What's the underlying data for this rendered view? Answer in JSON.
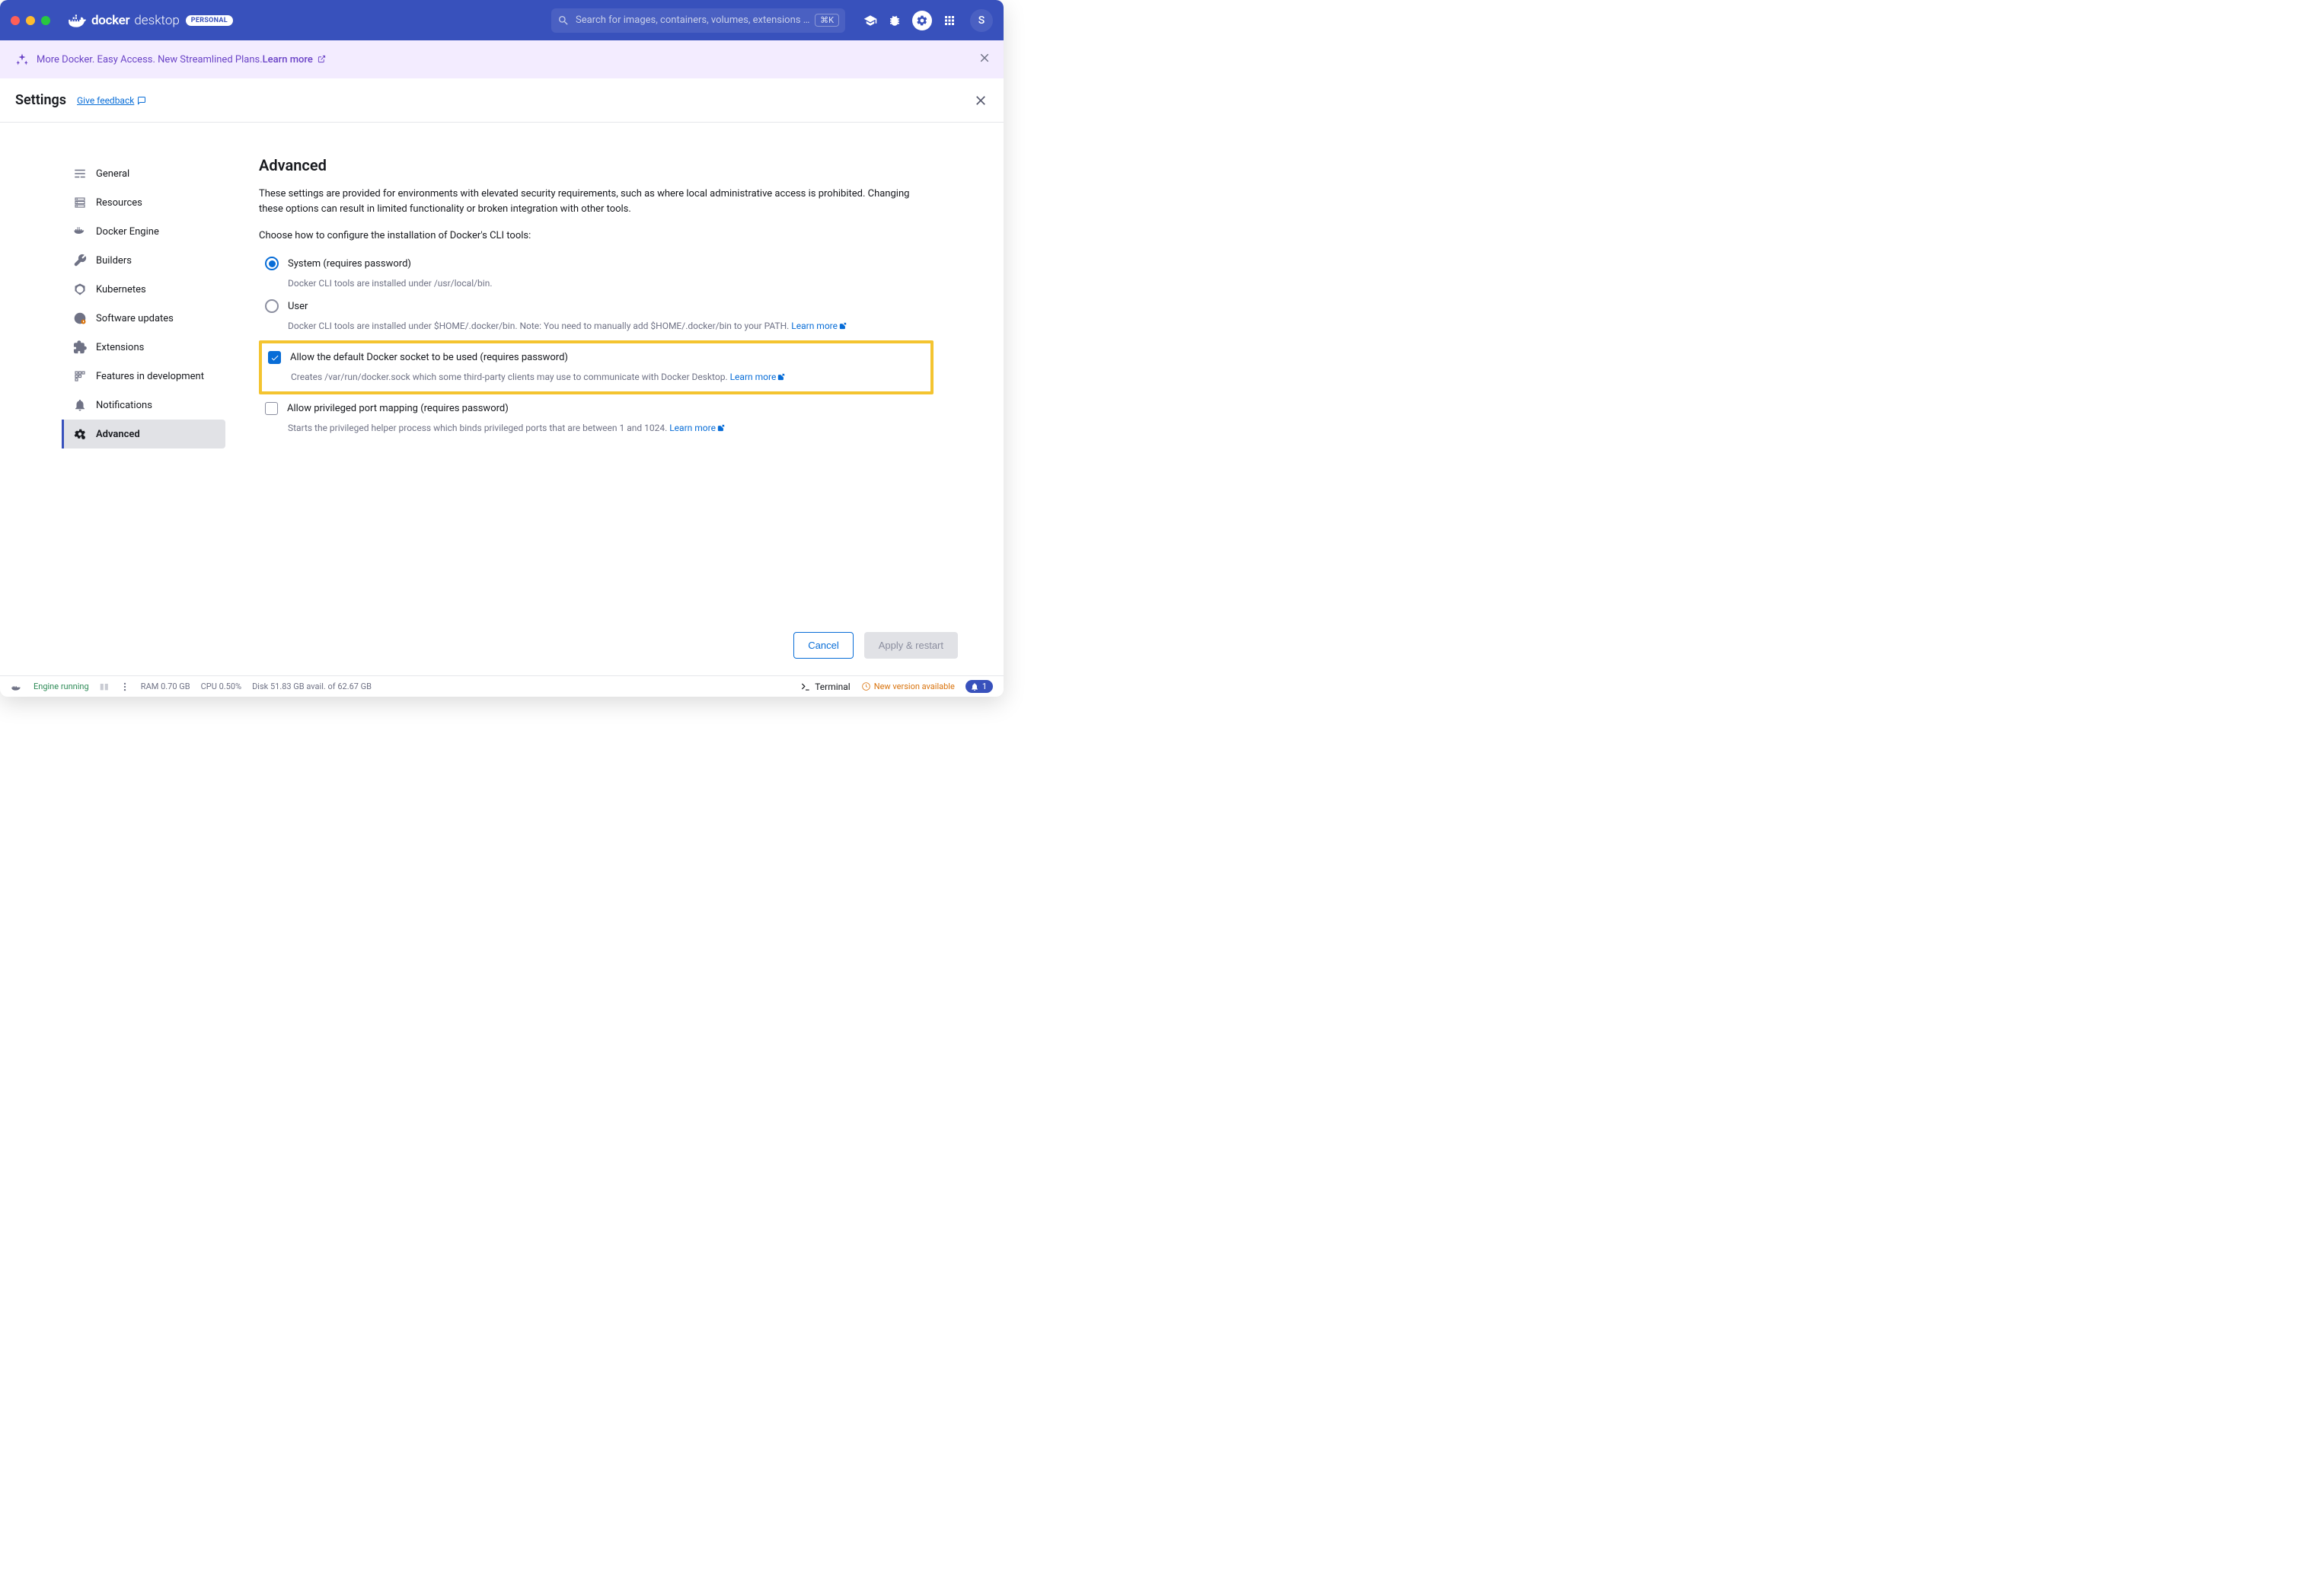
{
  "header": {
    "brand_name": "docker",
    "brand_sub": "desktop",
    "badge": "PERSONAL",
    "search_placeholder": "Search for images, containers, volumes, extensions …",
    "search_shortcut": "⌘K",
    "avatar_initial": "S"
  },
  "banner": {
    "text": "More Docker. Easy Access. New Streamlined Plans. ",
    "learn_more": "Learn more"
  },
  "settings": {
    "title": "Settings",
    "feedback": "Give feedback",
    "nav": [
      {
        "label": "General"
      },
      {
        "label": "Resources"
      },
      {
        "label": "Docker Engine"
      },
      {
        "label": "Builders"
      },
      {
        "label": "Kubernetes"
      },
      {
        "label": "Software updates"
      },
      {
        "label": "Extensions"
      },
      {
        "label": "Features in development"
      },
      {
        "label": "Notifications"
      },
      {
        "label": "Advanced"
      }
    ],
    "active_index": 9,
    "content": {
      "heading": "Advanced",
      "description": "These settings are provided for environments with elevated security requirements, such as where local administrative access is prohibited. Changing these options can result in limited functionality or broken integration with other tools.",
      "cli_prompt": "Choose how to configure the installation of Docker's CLI tools:",
      "radio": [
        {
          "label": "System (requires password)",
          "help": "Docker CLI tools are installed under /usr/local/bin.",
          "checked": true
        },
        {
          "label": "User",
          "help": "Docker CLI tools are installed under $HOME/.docker/bin. Note: You need to manually add $HOME/.docker/bin to your PATH. ",
          "learn_more": "Learn more",
          "checked": false
        }
      ],
      "checks": [
        {
          "label": "Allow the default Docker socket to be used (requires password)",
          "help": "Creates /var/run/docker.sock which some third-party clients may use to communicate with Docker Desktop. ",
          "learn_more": "Learn more",
          "checked": true,
          "highlight": true
        },
        {
          "label": "Allow privileged port mapping (requires password)",
          "help": "Starts the privileged helper process which binds privileged ports that are between 1 and 1024. ",
          "learn_more": "Learn more",
          "checked": false,
          "highlight": false
        }
      ]
    },
    "buttons": {
      "cancel": "Cancel",
      "apply": "Apply & restart"
    }
  },
  "status": {
    "engine": "Engine running",
    "ram": "RAM 0.70 GB",
    "cpu": "CPU 0.50%",
    "disk": "Disk 51.83 GB avail. of 62.67 GB",
    "terminal": "Terminal",
    "new_version": "New version available",
    "notif_count": "1"
  }
}
